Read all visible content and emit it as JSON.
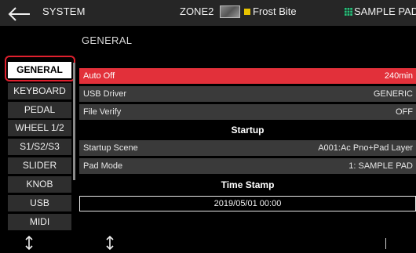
{
  "header": {
    "section": "SYSTEM",
    "zone": "ZONE2",
    "scene_name": "Frost Bite",
    "mode": "SAMPLE PAD",
    "icons": [
      "back-arrow-icon",
      "scene-thumbnail-icon",
      "scene-marker-icon",
      "sample-pad-grid-icon"
    ]
  },
  "page": {
    "title": "GENERAL"
  },
  "menu": {
    "items": [
      "GENERAL",
      "KEYBOARD",
      "PEDAL",
      "WHEEL 1/2",
      "S1/S2/S3",
      "SLIDER",
      "KNOB",
      "USB",
      "MIDI"
    ],
    "selected": "GENERAL"
  },
  "params": [
    {
      "name": "Auto Off",
      "value": "240min"
    },
    {
      "name": "USB Driver",
      "value": "GENERIC"
    },
    {
      "name": "File Verify",
      "value": "OFF"
    }
  ],
  "sections": {
    "startup": "Startup",
    "time_stamp": "Time Stamp"
  },
  "startup_params": [
    {
      "name": "Startup Scene",
      "value": "A001:Ac Pno+Pad Layer"
    },
    {
      "name": "Pad Mode",
      "value": "1: SAMPLE PAD"
    }
  ],
  "time_stamp": {
    "value": "2019/05/01  00:00"
  },
  "colors": {
    "accent": "#e2303a",
    "focus_ring": "#e0202e",
    "row_bg": "#3a3a3a",
    "menu_bg": "#2e2e2e",
    "pad_icon": "#27c07a",
    "scene_marker": "#e8c300"
  }
}
